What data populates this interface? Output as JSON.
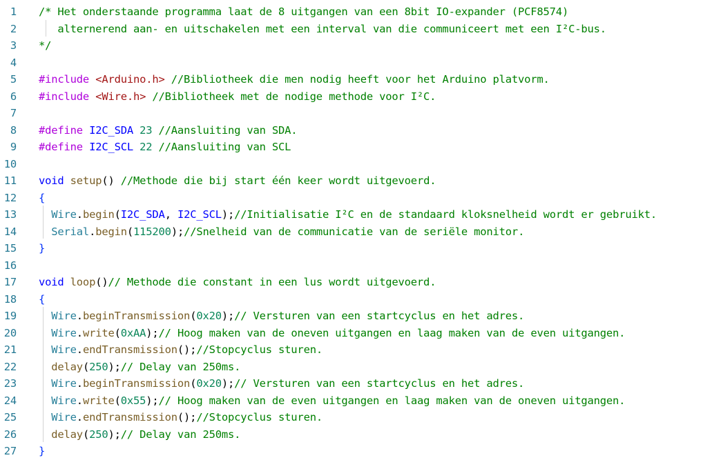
{
  "colors": {
    "line_number": "#237893",
    "comment": "#008000",
    "keyword": "#0000ff",
    "preprocessor": "#af00db",
    "string": "#a31515",
    "number": "#098658",
    "type": "#267f99",
    "function": "#795e26",
    "text": "#000000",
    "brace": "#0431fa"
  },
  "lines": [
    {
      "n": "1",
      "tokens": [
        {
          "t": "comment",
          "v": "/* Het onderstaande programma laat de 8 uitgangen van een 8bit IO-expander (PCF8574)"
        }
      ]
    },
    {
      "n": "2",
      "tokens": [
        {
          "t": "comment",
          "v": "   alternerend aan- en uitschakelen met een interval van die communiceert met een I²C-bus."
        }
      ]
    },
    {
      "n": "3",
      "tokens": [
        {
          "t": "comment",
          "v": "*/"
        }
      ]
    },
    {
      "n": "4",
      "tokens": []
    },
    {
      "n": "5",
      "tokens": [
        {
          "t": "preprocessor",
          "v": "#include "
        },
        {
          "t": "string",
          "v": "<Arduino.h>"
        },
        {
          "t": "comment",
          "v": " //Bibliotheek die men nodig heeft voor het Arduino platvorm."
        }
      ]
    },
    {
      "n": "6",
      "tokens": [
        {
          "t": "preprocessor",
          "v": "#include "
        },
        {
          "t": "string",
          "v": "<Wire.h>"
        },
        {
          "t": "comment",
          "v": " //Bibliotheek met de nodige methode voor I²C."
        }
      ]
    },
    {
      "n": "7",
      "tokens": []
    },
    {
      "n": "8",
      "tokens": [
        {
          "t": "preprocessor",
          "v": "#define "
        },
        {
          "t": "macro",
          "v": "I2C_SDA"
        },
        {
          "t": "text",
          "v": " "
        },
        {
          "t": "number",
          "v": "23"
        },
        {
          "t": "comment",
          "v": " //Aansluiting van SDA."
        }
      ]
    },
    {
      "n": "9",
      "tokens": [
        {
          "t": "preprocessor",
          "v": "#define "
        },
        {
          "t": "macro",
          "v": "I2C_SCL"
        },
        {
          "t": "text",
          "v": " "
        },
        {
          "t": "number",
          "v": "22"
        },
        {
          "t": "comment",
          "v": " //Aansluiting van SCL"
        }
      ]
    },
    {
      "n": "10",
      "tokens": []
    },
    {
      "n": "11",
      "tokens": [
        {
          "t": "keyword",
          "v": "void"
        },
        {
          "t": "text",
          "v": " "
        },
        {
          "t": "function",
          "v": "setup"
        },
        {
          "t": "text",
          "v": "() "
        },
        {
          "t": "comment",
          "v": "//Methode die bij start één keer wordt uitgevoerd."
        }
      ]
    },
    {
      "n": "12",
      "tokens": [
        {
          "t": "brace",
          "v": "{"
        }
      ]
    },
    {
      "n": "13",
      "tokens": [
        {
          "t": "text",
          "v": "  "
        },
        {
          "t": "type",
          "v": "Wire"
        },
        {
          "t": "text",
          "v": "."
        },
        {
          "t": "function",
          "v": "begin"
        },
        {
          "t": "text",
          "v": "("
        },
        {
          "t": "macro",
          "v": "I2C_SDA"
        },
        {
          "t": "text",
          "v": ", "
        },
        {
          "t": "macro",
          "v": "I2C_SCL"
        },
        {
          "t": "text",
          "v": ");"
        },
        {
          "t": "comment",
          "v": "//Initialisatie I²C en de standaard kloksnelheid wordt er gebruikt."
        }
      ]
    },
    {
      "n": "14",
      "tokens": [
        {
          "t": "text",
          "v": "  "
        },
        {
          "t": "type",
          "v": "Serial"
        },
        {
          "t": "text",
          "v": "."
        },
        {
          "t": "function",
          "v": "begin"
        },
        {
          "t": "text",
          "v": "("
        },
        {
          "t": "number",
          "v": "115200"
        },
        {
          "t": "text",
          "v": ");"
        },
        {
          "t": "comment",
          "v": "//Snelheid van de communicatie van de seriële monitor."
        }
      ]
    },
    {
      "n": "15",
      "tokens": [
        {
          "t": "brace",
          "v": "}"
        }
      ]
    },
    {
      "n": "16",
      "tokens": []
    },
    {
      "n": "17",
      "tokens": [
        {
          "t": "keyword",
          "v": "void"
        },
        {
          "t": "text",
          "v": " "
        },
        {
          "t": "function",
          "v": "loop"
        },
        {
          "t": "text",
          "v": "()"
        },
        {
          "t": "comment",
          "v": "// Methode die constant in een lus wordt uitgevoerd."
        }
      ]
    },
    {
      "n": "18",
      "tokens": [
        {
          "t": "brace",
          "v": "{"
        }
      ]
    },
    {
      "n": "19",
      "tokens": [
        {
          "t": "text",
          "v": "  "
        },
        {
          "t": "type",
          "v": "Wire"
        },
        {
          "t": "text",
          "v": "."
        },
        {
          "t": "function",
          "v": "beginTransmission"
        },
        {
          "t": "text",
          "v": "("
        },
        {
          "t": "number",
          "v": "0x20"
        },
        {
          "t": "text",
          "v": ");"
        },
        {
          "t": "comment",
          "v": "// Versturen van een startcyclus en het adres."
        }
      ]
    },
    {
      "n": "20",
      "tokens": [
        {
          "t": "text",
          "v": "  "
        },
        {
          "t": "type",
          "v": "Wire"
        },
        {
          "t": "text",
          "v": "."
        },
        {
          "t": "function",
          "v": "write"
        },
        {
          "t": "text",
          "v": "("
        },
        {
          "t": "number",
          "v": "0xAA"
        },
        {
          "t": "text",
          "v": ");"
        },
        {
          "t": "comment",
          "v": "// Hoog maken van de oneven uitgangen en laag maken van de even uitgangen."
        }
      ]
    },
    {
      "n": "21",
      "tokens": [
        {
          "t": "text",
          "v": "  "
        },
        {
          "t": "type",
          "v": "Wire"
        },
        {
          "t": "text",
          "v": "."
        },
        {
          "t": "function",
          "v": "endTransmission"
        },
        {
          "t": "text",
          "v": "();"
        },
        {
          "t": "comment",
          "v": "//Stopcyclus sturen."
        }
      ]
    },
    {
      "n": "22",
      "tokens": [
        {
          "t": "text",
          "v": "  "
        },
        {
          "t": "function",
          "v": "delay"
        },
        {
          "t": "text",
          "v": "("
        },
        {
          "t": "number",
          "v": "250"
        },
        {
          "t": "text",
          "v": ");"
        },
        {
          "t": "comment",
          "v": "// Delay van 250ms."
        }
      ]
    },
    {
      "n": "23",
      "tokens": [
        {
          "t": "text",
          "v": "  "
        },
        {
          "t": "type",
          "v": "Wire"
        },
        {
          "t": "text",
          "v": "."
        },
        {
          "t": "function",
          "v": "beginTransmission"
        },
        {
          "t": "text",
          "v": "("
        },
        {
          "t": "number",
          "v": "0x20"
        },
        {
          "t": "text",
          "v": ");"
        },
        {
          "t": "comment",
          "v": "// Versturen van een startcyclus en het adres."
        }
      ]
    },
    {
      "n": "24",
      "tokens": [
        {
          "t": "text",
          "v": "  "
        },
        {
          "t": "type",
          "v": "Wire"
        },
        {
          "t": "text",
          "v": "."
        },
        {
          "t": "function",
          "v": "write"
        },
        {
          "t": "text",
          "v": "("
        },
        {
          "t": "number",
          "v": "0x55"
        },
        {
          "t": "text",
          "v": ");"
        },
        {
          "t": "comment",
          "v": "// Hoog maken van de even uitgangen en laag maken van de oneven uitgangen."
        }
      ]
    },
    {
      "n": "25",
      "tokens": [
        {
          "t": "text",
          "v": "  "
        },
        {
          "t": "type",
          "v": "Wire"
        },
        {
          "t": "text",
          "v": "."
        },
        {
          "t": "function",
          "v": "endTransmission"
        },
        {
          "t": "text",
          "v": "();"
        },
        {
          "t": "comment",
          "v": "//Stopcyclus sturen."
        }
      ]
    },
    {
      "n": "26",
      "tokens": [
        {
          "t": "text",
          "v": "  "
        },
        {
          "t": "function",
          "v": "delay"
        },
        {
          "t": "text",
          "v": "("
        },
        {
          "t": "number",
          "v": "250"
        },
        {
          "t": "text",
          "v": ");"
        },
        {
          "t": "comment",
          "v": "// Delay van 250ms."
        }
      ]
    },
    {
      "n": "27",
      "tokens": [
        {
          "t": "brace",
          "v": "}"
        }
      ]
    }
  ]
}
